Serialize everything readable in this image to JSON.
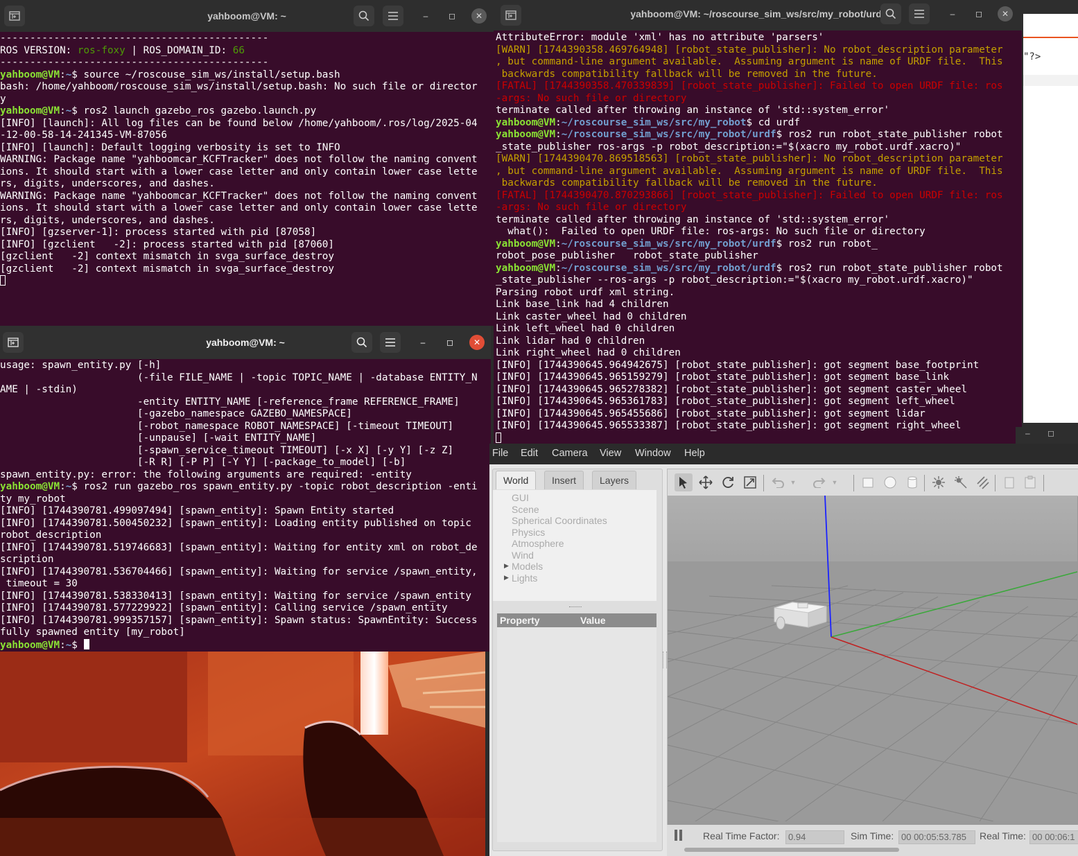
{
  "term1": {
    "title": "yahboom@VM: ~",
    "lines": [
      "---------------------------------------------",
      "ROS VERSION: ros-foxy | ROS_DOMAIN_ID: 66",
      "---------------------------------------------",
      "yahboom@VM:~$ source ~/roscouse_sim_ws/install/setup.bash",
      "bash: /home/yahboom/roscouse_sim_ws/install/setup.bash: No such file or director",
      "y",
      "yahboom@VM:~$ ros2 launch gazebo_ros gazebo.launch.py",
      "[INFO] [launch]: All log files can be found below /home/yahboom/.ros/log/2025-04",
      "-12-00-58-14-241345-VM-87056",
      "[INFO] [launch]: Default logging verbosity is set to INFO",
      "WARNING: Package name \"yahboomcar_KCFTracker\" does not follow the naming convent",
      "ions. It should start with a lower case letter and only contain lower case lette",
      "rs, digits, underscores, and dashes.",
      "WARNING: Package name \"yahboomcar_KCFTracker\" does not follow the naming convent",
      "ions. It should start with a lower case letter and only contain lower case lette",
      "rs, digits, underscores, and dashes.",
      "[INFO] [gzserver-1]: process started with pid [87058]",
      "[INFO] [gzclient   -2]: process started with pid [87060]",
      "[gzclient   -2] context mismatch in svga_surface_destroy",
      "[gzclient   -2] context mismatch in svga_surface_destroy"
    ]
  },
  "term2": {
    "title": "yahboom@VM: ~",
    "lines": [
      "usage: spawn_entity.py [-h]",
      "                       (-file FILE_NAME | -topic TOPIC_NAME | -database ENTITY_N",
      "AME | -stdin)",
      "                       -entity ENTITY_NAME [-reference_frame REFERENCE_FRAME]",
      "                       [-gazebo_namespace GAZEBO_NAMESPACE]",
      "                       [-robot_namespace ROBOT_NAMESPACE] [-timeout TIMEOUT]",
      "                       [-unpause] [-wait ENTITY_NAME]",
      "                       [-spawn_service_timeout TIMEOUT] [-x X] [-y Y] [-z Z]",
      "                       [-R R] [-P P] [-Y Y] [-package_to_model] [-b]",
      "spawn_entity.py: error: the following arguments are required: -entity",
      "yahboom@VM:~$ ros2 run gazebo_ros spawn_entity.py -topic robot_description -enti",
      "ty my_robot",
      "[INFO] [1744390781.499097494] [spawn_entity]: Spawn Entity started",
      "[INFO] [1744390781.500450232] [spawn_entity]: Loading entity published on topic",
      "robot_description",
      "[INFO] [1744390781.519746683] [spawn_entity]: Waiting for entity xml on robot_de",
      "scription",
      "[INFO] [1744390781.536704466] [spawn_entity]: Waiting for service /spawn_entity,",
      " timeout = 30",
      "[INFO] [1744390781.538330413] [spawn_entity]: Waiting for service /spawn_entity",
      "[INFO] [1744390781.577229922] [spawn_entity]: Calling service /spawn_entity",
      "[INFO] [1744390781.999357157] [spawn_entity]: Spawn status: SpawnEntity: Success",
      "fully spawned entity [my_robot]",
      "yahboom@VM:~$ "
    ]
  },
  "term3": {
    "title": "yahboom@VM: ~/roscourse_sim_ws/src/my_robot/urdf",
    "lines": [
      "AttributeError: module 'xml' has no attribute 'parsers'",
      "[WARN] [1744390358.469764948] [robot_state_publisher]: No robot_description parameter",
      ", but command-line argument available.  Assuming argument is name of URDF file.  This",
      " backwards compatibility fallback will be removed in the future.",
      "[FATAL] [1744390358.470339839] [robot_state_publisher]: Failed to open URDF file: ros",
      "-args: No such file or directory",
      "terminate called after throwing an instance of 'std::system_error'",
      "yahboom@VM:~/roscourse_sim_ws/src/my_robot$ cd urdf",
      "yahboom@VM:~/roscourse_sim_ws/src/my_robot/urdf$ ros2 run robot_state_publisher robot",
      "_state_publisher ros-args -p robot_description:=\"$(xacro my_robot.urdf.xacro)\"",
      "[WARN] [1744390470.869518563] [robot_state_publisher]: No robot_description parameter",
      ", but command-line argument available.  Assuming argument is name of URDF file.  This",
      " backwards compatibility fallback will be removed in the future.",
      "[FATAL] [1744390470.870293866] [robot_state_publisher]: Failed to open URDF file: ros",
      "-args: No such file or directory",
      "terminate called after throwing an instance of 'std::system_error'",
      "  what():  Failed to open URDF file: ros-args: No such file or directory",
      "yahboom@VM:~/roscourse_sim_ws/src/my_robot/urdf$ ros2 run robot_",
      "robot_pose_publisher   robot_state_publisher",
      "yahboom@VM:~/roscourse_sim_ws/src/my_robot/urdf$ ros2 run robot_state_publisher robot",
      "_state_publisher --ros-args -p robot_description:=\"$(xacro my_robot.urdf.xacro)\"",
      "Parsing robot urdf xml string.",
      "Link base_link had 4 children",
      "Link caster_wheel had 0 children",
      "Link left_wheel had 0 children",
      "Link lidar had 0 children",
      "Link right_wheel had 0 children",
      "[INFO] [1744390645.964942675] [robot_state_publisher]: got segment base_footprint",
      "[INFO] [1744390645.965159279] [robot_state_publisher]: got segment base_link",
      "[INFO] [1744390645.965278382] [robot_state_publisher]: got segment caster_wheel",
      "[INFO] [1744390645.965361783] [robot_state_publisher]: got segment left_wheel",
      "[INFO] [1744390645.965455686] [robot_state_publisher]: got segment lidar",
      "[INFO] [1744390645.965533387] [robot_state_publisher]: got segment right_wheel"
    ]
  },
  "editor": {
    "snippet": "\"?>"
  },
  "gazebo": {
    "menu": [
      "File",
      "Edit",
      "Camera",
      "View",
      "Window",
      "Help"
    ],
    "tabs": [
      "World",
      "Insert",
      "Layers"
    ],
    "tree": [
      "GUI",
      "Scene",
      "Spherical Coordinates",
      "Physics",
      "Atmosphere",
      "Wind",
      "Models",
      "Lights"
    ],
    "property_header": "Property",
    "value_header": "Value",
    "rtf_label": "Real Time Factor:",
    "rtf_value": "0.94",
    "sim_time_label": "Sim Time:",
    "sim_time_value": "00 00:05:53.785",
    "real_time_label": "Real Time:",
    "real_time_value": "00 00:06:1"
  },
  "colors": {
    "terminal_bg": "#380c2a",
    "prompt_user": "#8ae234",
    "prompt_path": "#729fcf",
    "warn": "#c4a000",
    "fatal": "#cc0000"
  }
}
